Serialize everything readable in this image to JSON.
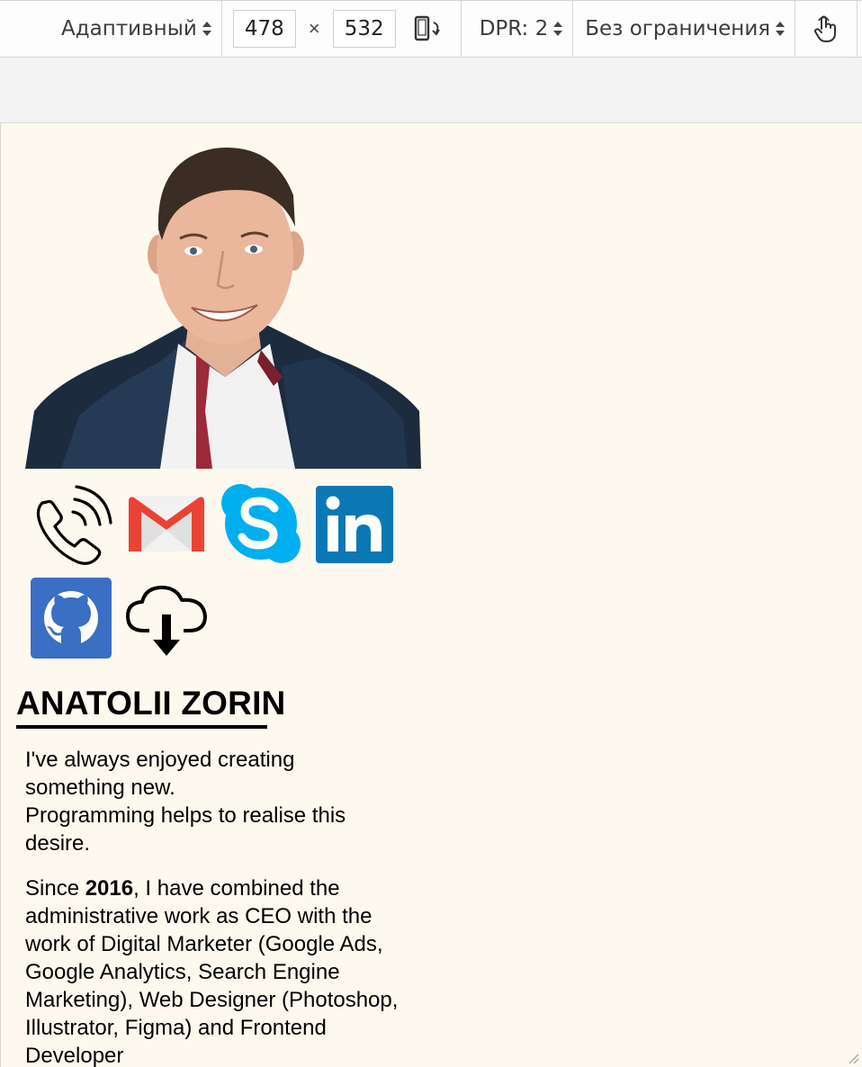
{
  "toolbar": {
    "device_label": "Адаптивный",
    "width_value": "478",
    "times_sign": "×",
    "height_value": "532",
    "dpr_label": "DPR: 2",
    "throttle_label": "Без ограничения"
  },
  "profile": {
    "name": "ANATOLII ZORIN",
    "para1_line1": "I've always enjoyed creating",
    "para1_line2": "something new.",
    "para1_line3": "Programming helps to realise this",
    "para1_line4": "desire.",
    "para2_pre": "Since ",
    "para2_year": "2016",
    "para2_rest": ", I have combined the administrative work as CEO with the work of Digital Marketer (Google Ads, Google Analytics, Search Engine Marketing), Web Designer (Photoshop, Illustrator, Figma) and Frontend Developer",
    "contacts": [
      "phone-icon",
      "gmail-icon",
      "skype-icon",
      "linkedin-icon",
      "github-icon",
      "cloud-download-icon"
    ]
  },
  "colors": {
    "page_bg": "#fdf9ef",
    "gmail_red": "#ea4335",
    "skype_blue": "#00aff0",
    "linkedin_blue": "#0a78b5",
    "github_blue": "#3b6fc4"
  }
}
